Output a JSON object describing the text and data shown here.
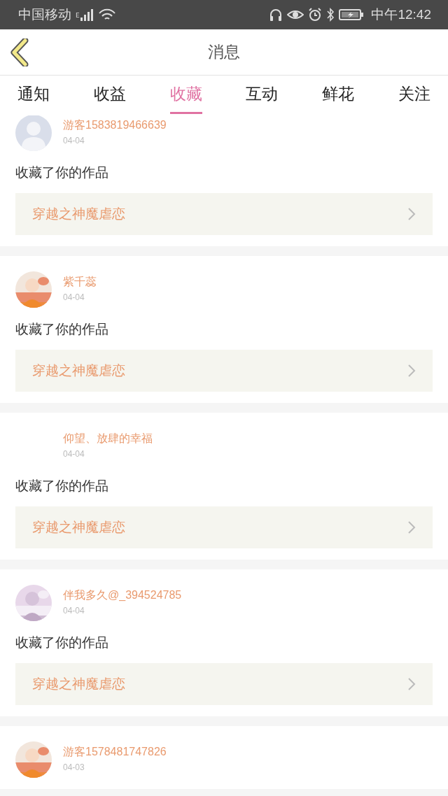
{
  "status_bar": {
    "carrier": "中国移动",
    "network": "E",
    "time": "中午12:42"
  },
  "header": {
    "title": "消息"
  },
  "tabs": [
    {
      "label": "通知",
      "selected": false
    },
    {
      "label": "收益",
      "selected": false
    },
    {
      "label": "收藏",
      "selected": true
    },
    {
      "label": "互动",
      "selected": false
    },
    {
      "label": "鲜花",
      "selected": false
    },
    {
      "label": "关注",
      "selected": false
    }
  ],
  "messages": [
    {
      "avatar": {
        "kind": "silhouette"
      },
      "name": "游客1583819466639",
      "date": "04-04",
      "text": "收藏了你的作品",
      "work": "穿越之神魔虐恋"
    },
    {
      "name": "紫千蕊",
      "date": "04-04",
      "text": "收藏了你的作品",
      "work": "穿越之神魔虐恋"
    },
    {
      "name": "仰望、放肆的幸福",
      "date": "04-04",
      "text": "收藏了你的作品",
      "work": "穿越之神魔虐恋"
    },
    {
      "name": "伴我多久@_394524785",
      "date": "04-04",
      "text": "收藏了你的作品",
      "work": "穿越之神魔虐恋"
    },
    {
      "name": "游客1578481747826",
      "date": "04-03"
    }
  ]
}
